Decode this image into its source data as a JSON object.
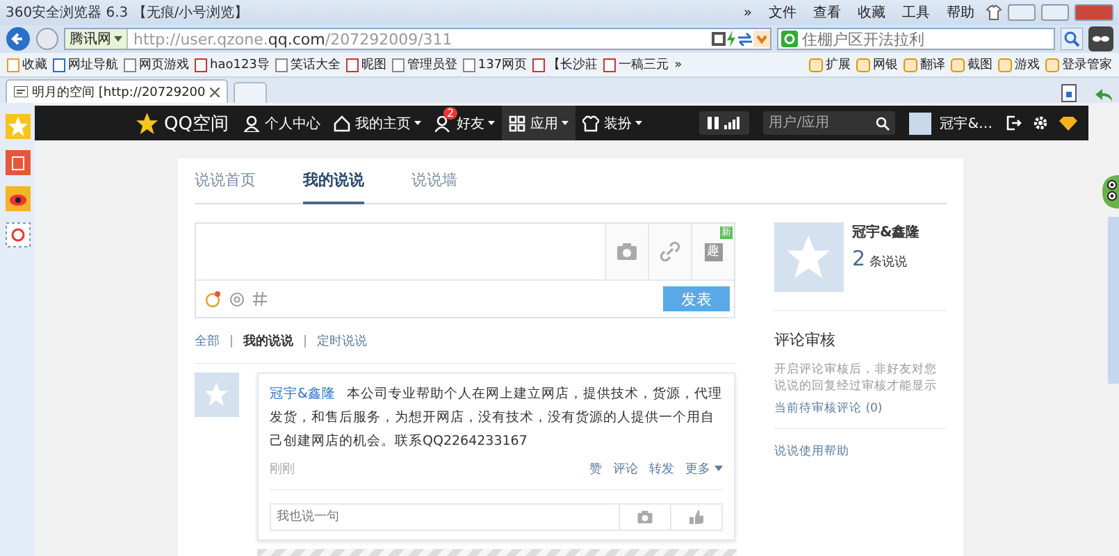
{
  "browser": {
    "title": "360安全浏览器 6.3 【无痕/小号浏览】",
    "menu": [
      "»",
      "文件",
      "查看",
      "收藏",
      "工具",
      "帮助"
    ],
    "site_label": "腾讯网",
    "url_host": "http://user.qzone.",
    "url_domain": "qq.com",
    "url_path": "/207292009/311",
    "search_placeholder": "住棚户区开法拉利",
    "bookmarks": [
      "收藏",
      "网址导航",
      "网页游戏",
      "hao123导",
      "笑话大全",
      "昵图",
      "管理员登",
      "137网页",
      "【长沙莊",
      "一稿三元",
      "»"
    ],
    "tools": [
      "扩展",
      "网银",
      "翻译",
      "截图",
      "游戏",
      "登录管家"
    ],
    "tabs": [
      {
        "label": "明月的空间 [http://20729200",
        "selected": true
      }
    ]
  },
  "nav": {
    "logo": "QQ空间",
    "items": [
      {
        "kind": "person",
        "label": "个人中心",
        "dropdown": false,
        "selected": false
      },
      {
        "kind": "home",
        "label": "我的主页",
        "dropdown": true,
        "selected": false
      },
      {
        "kind": "friends",
        "label": "好友",
        "dropdown": true,
        "selected": false,
        "badge": "2"
      },
      {
        "kind": "apps",
        "label": "应用",
        "dropdown": true,
        "selected": true
      },
      {
        "kind": "shirt",
        "label": "装扮",
        "dropdown": true,
        "selected": false
      }
    ],
    "search_placeholder": "用户/应用",
    "user": "冠宇&…"
  },
  "content": {
    "tabs": [
      {
        "label": "说说首页",
        "selected": false
      },
      {
        "label": "我的说说",
        "selected": true
      },
      {
        "label": "说说墙",
        "selected": false
      }
    ],
    "composer": {
      "fun_label": "趣",
      "new_badge": "新",
      "submit": "发表"
    },
    "filters": [
      {
        "label": "全部",
        "selected": false
      },
      {
        "label": "我的说说",
        "selected": true
      },
      {
        "label": "定时说说",
        "selected": false
      }
    ],
    "posts": [
      {
        "author": "冠宇&鑫隆",
        "text": "本公司专业帮助个人在网上建立网店，提供技术，货源，代理发货，和售后服务，为想开网店，没有技术，没有货源的人提供一个用自己创建网店的机会。联系QQ2264233167",
        "time": "刚刚",
        "actions": [
          "赞",
          "评论",
          "转发",
          "更多"
        ],
        "reply_placeholder": "我也说一句"
      }
    ]
  },
  "profile": {
    "name": "冠宇&鑫隆",
    "count": "2",
    "count_label": "条说说"
  },
  "review": {
    "title": "评论审核",
    "description": "开启评论审核后，非好友对您说说的回复经过审核才能显示",
    "pending_link": "当前待审核评论 (0)"
  },
  "help_link": "说说使用帮助"
}
